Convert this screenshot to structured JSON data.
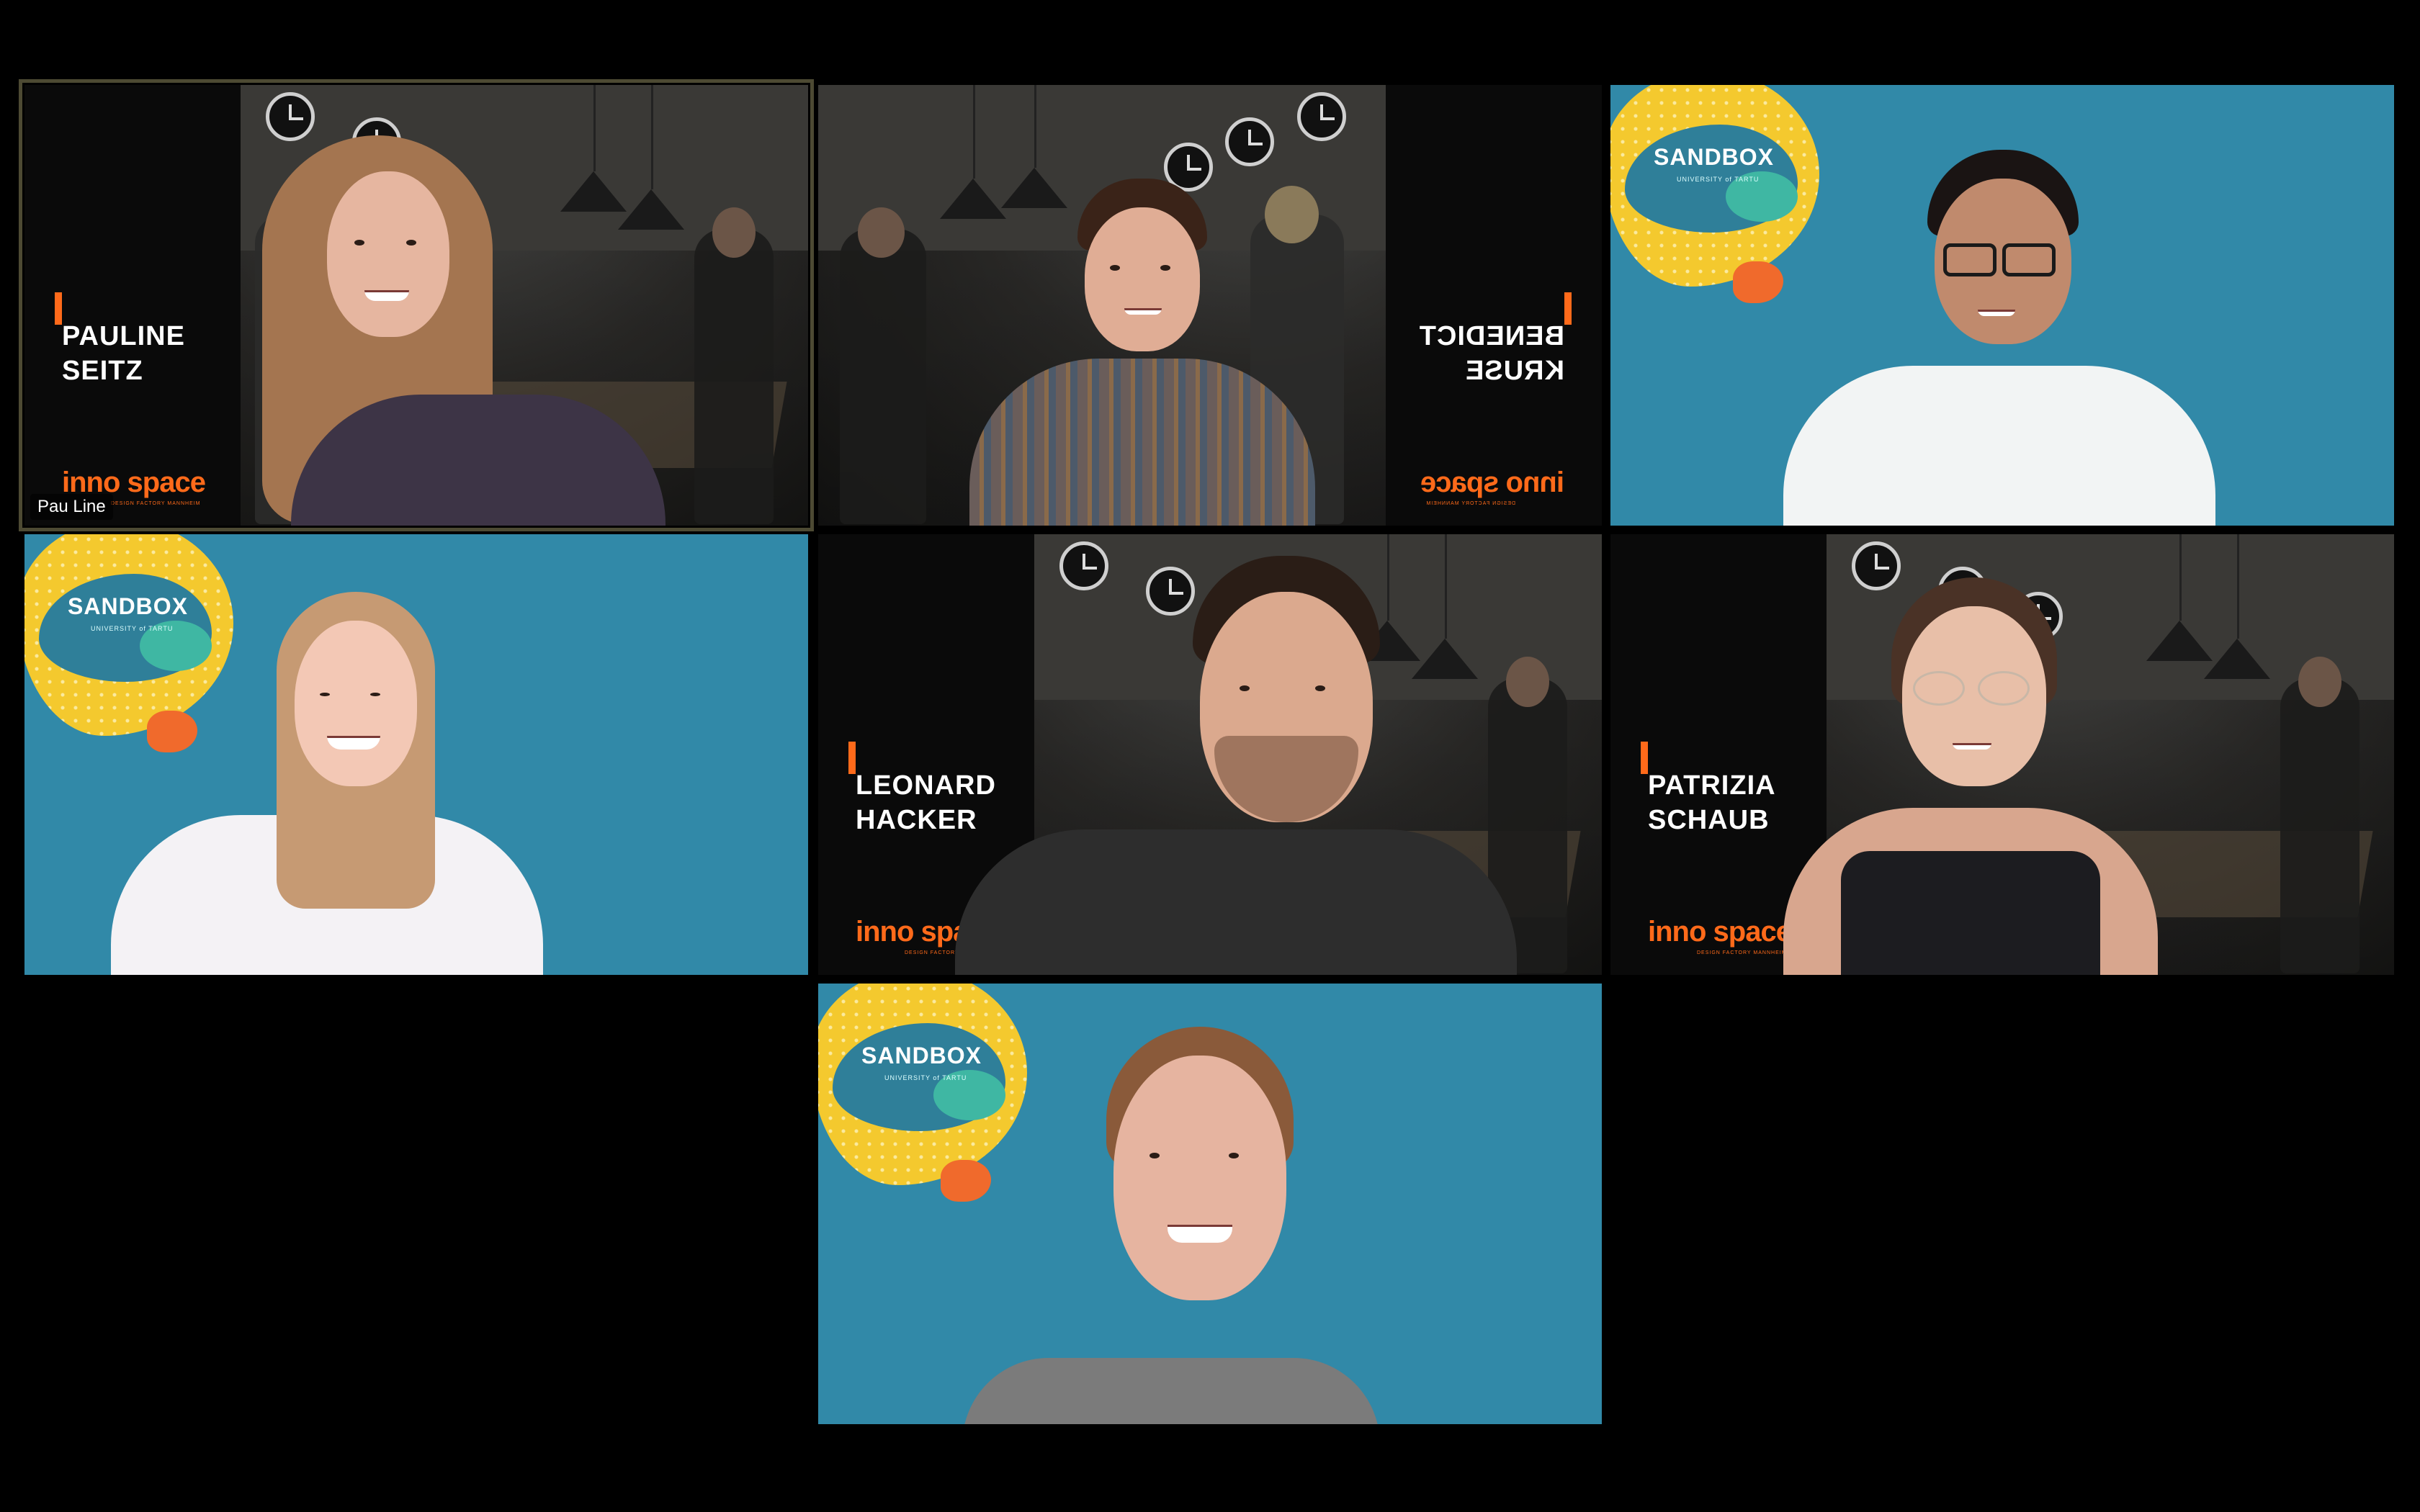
{
  "meeting": {
    "tiles": [
      {
        "id": "t1",
        "name_label": "Pau Line",
        "overlay_first": "PAULINE",
        "overlay_last": "SEITZ",
        "background": "inno space"
      },
      {
        "id": "t2",
        "overlay_first": "BENEDICT",
        "overlay_last": "KRUSE",
        "background": "inno space"
      },
      {
        "id": "t3",
        "background": "sandbox"
      },
      {
        "id": "t4",
        "background": "sandbox"
      },
      {
        "id": "t5",
        "overlay_first": "LEONARD",
        "overlay_last": "HACKER",
        "background": "inno space"
      },
      {
        "id": "t6",
        "overlay_first": "PATRIZIA",
        "overlay_last": "SCHAUB",
        "background": "inno space"
      },
      {
        "id": "t7",
        "background": "sandbox"
      }
    ],
    "brand_innospace": "inno space",
    "brand_innospace_sub": "DESIGN FACTORY MANNHEIM",
    "brand_sandbox": "SANDBOX",
    "brand_sandbox_sub": "UNIVERSITY of TARTU"
  },
  "colors": {
    "sandbox_bg": "#3189a8",
    "orange": "#ff6a1a",
    "yellow": "#f4c92e",
    "active_border": "#4d4a33"
  }
}
